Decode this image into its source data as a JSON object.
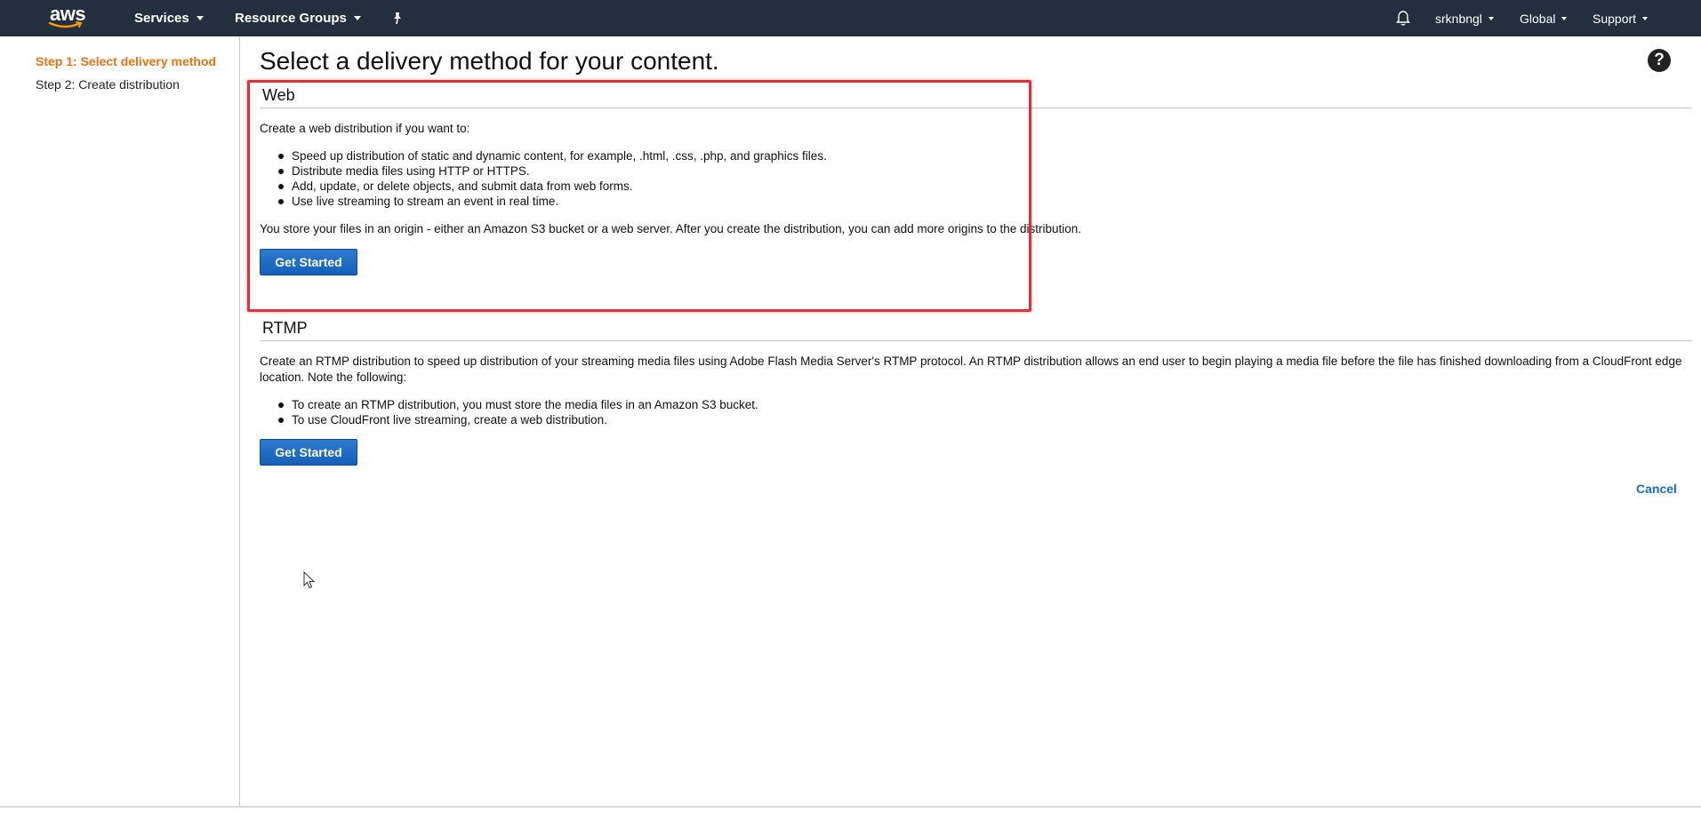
{
  "nav": {
    "logo_text": "aws",
    "services_label": "Services",
    "resource_groups_label": "Resource Groups",
    "pin_icon": "pin-icon",
    "bell_icon": "bell-icon",
    "account_label": "srknbngl",
    "region_label": "Global",
    "support_label": "Support",
    "bg_color": "#232f3e"
  },
  "sidebar": {
    "steps": [
      {
        "label": "Step 1: Select delivery method",
        "active": true
      },
      {
        "label": "Step 2: Create distribution",
        "active": false
      }
    ],
    "active_color": "#ec7211"
  },
  "main": {
    "title": "Select a delivery method for your content.",
    "help_icon": "help-icon",
    "help_glyph": "?",
    "web": {
      "heading": "Web",
      "intro": "Create a web distribution if you want to:",
      "bullets": [
        "Speed up distribution of static and dynamic content, for example, .html, .css, .php, and graphics files.",
        "Distribute media files using HTTP or HTTPS.",
        "Add, update, or delete objects, and submit data from web forms.",
        "Use live streaming to stream an event in real time."
      ],
      "note": "You store your files in an origin - either an Amazon S3 bucket or a web server. After you create the distribution, you can add more origins to the distribution.",
      "button_label": "Get Started"
    },
    "rtmp": {
      "heading": "RTMP",
      "intro": "Create an RTMP distribution to speed up distribution of your streaming media files using Adobe Flash Media Server's RTMP protocol. An RTMP distribution allows an end user to begin playing a media file before the file has finished downloading from a CloudFront edge location. Note the following:",
      "bullets": [
        "To create an RTMP distribution, you must store the media files in an Amazon S3 bucket.",
        "To use CloudFront live streaming, create a web distribution."
      ],
      "button_label": "Get Started"
    },
    "cancel_label": "Cancel",
    "link_color": "#1a6fc9",
    "button_color": "#1f6cc6",
    "highlight_color": "#e0303b"
  }
}
